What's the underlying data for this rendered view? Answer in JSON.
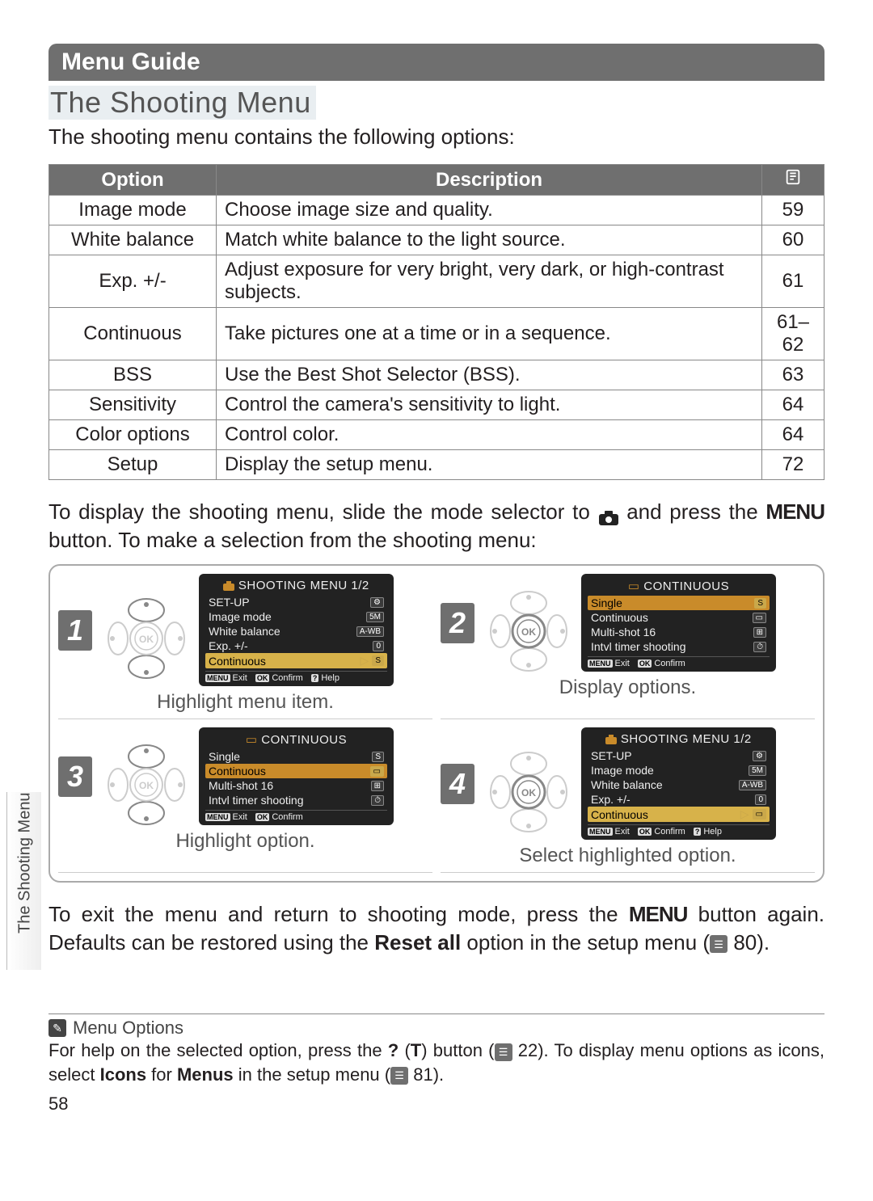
{
  "header": {
    "menu_guide": "Menu Guide"
  },
  "section": {
    "title": "The Shooting Menu",
    "intro": "The shooting menu contains the following options:"
  },
  "table": {
    "headers": {
      "option": "Option",
      "description": "Description"
    },
    "rows": [
      {
        "option": "Image mode",
        "desc": "Choose image size and quality.",
        "page": "59"
      },
      {
        "option": "White balance",
        "desc": "Match white balance to the light source.",
        "page": "60"
      },
      {
        "option": "Exp. +/-",
        "desc": "Adjust exposure for very bright, very dark, or high-contrast subjects.",
        "page": "61"
      },
      {
        "option": "Continuous",
        "desc": "Take pictures one at a time or in a sequence.",
        "page": "61–62"
      },
      {
        "option": "BSS",
        "desc": "Use the Best Shot Selector (BSS).",
        "page": "63"
      },
      {
        "option": "Sensitivity",
        "desc": "Control the camera's sensitivity to light.",
        "page": "64"
      },
      {
        "option": "Color options",
        "desc": "Control color.",
        "page": "64"
      },
      {
        "option": "Setup",
        "desc": "Display the setup menu.",
        "page": "72"
      }
    ]
  },
  "body1": {
    "pre": "To display the shooting menu, slide the mode selector to ",
    "mid": " and press the ",
    "menu_word": "MENU",
    "post": " button.  To make a selection from the shooting menu:"
  },
  "steps": [
    {
      "num": "1",
      "caption": "Highlight menu item.",
      "dpad": "vertical",
      "lcd": {
        "title": "SHOOTING MENU  1/2",
        "icon": "camera",
        "rows": [
          {
            "label": "SET-UP",
            "badge": "⚙",
            "sel": false
          },
          {
            "label": "Image mode",
            "badge": "5M",
            "sel": false
          },
          {
            "label": "White balance",
            "badge": "A-WB",
            "sel": false
          },
          {
            "label": "Exp. +/-",
            "badge": "0",
            "sel": false
          },
          {
            "label": "Continuous",
            "badge": "S",
            "sel": true,
            "arrow": true
          }
        ],
        "footer": [
          "MENU Exit",
          "OK Confirm",
          "? Help"
        ]
      }
    },
    {
      "num": "2",
      "caption": "Display options.",
      "dpad": "ok",
      "lcd": {
        "title": "CONTINUOUS",
        "icon": "burst",
        "rows": [
          {
            "label": "Single",
            "badge": "S",
            "sel": true
          },
          {
            "label": "Continuous",
            "badge": "▭",
            "sel": false
          },
          {
            "label": "Multi-shot 16",
            "badge": "⊞",
            "sel": false
          },
          {
            "label": "Intvl timer shooting",
            "badge": "⏱",
            "sel": false
          }
        ],
        "footer": [
          "MENU Exit",
          "OK Confirm"
        ]
      }
    },
    {
      "num": "3",
      "caption": "Highlight option.",
      "dpad": "vertical",
      "lcd": {
        "title": "CONTINUOUS",
        "icon": "burst",
        "rows": [
          {
            "label": "Single",
            "badge": "S",
            "sel": false
          },
          {
            "label": "Continuous",
            "badge": "▭",
            "sel": true
          },
          {
            "label": "Multi-shot 16",
            "badge": "⊞",
            "sel": false
          },
          {
            "label": "Intvl timer shooting",
            "badge": "⏱",
            "sel": false
          }
        ],
        "footer": [
          "MENU Exit",
          "OK Confirm"
        ]
      }
    },
    {
      "num": "4",
      "caption": "Select highlighted option.",
      "dpad": "ok",
      "lcd": {
        "title": "SHOOTING MENU  1/2",
        "icon": "camera",
        "rows": [
          {
            "label": "SET-UP",
            "badge": "⚙",
            "sel": false
          },
          {
            "label": "Image mode",
            "badge": "5M",
            "sel": false
          },
          {
            "label": "White balance",
            "badge": "A-WB",
            "sel": false
          },
          {
            "label": "Exp. +/-",
            "badge": "0",
            "sel": false
          },
          {
            "label": "Continuous",
            "badge": "▭",
            "sel": true,
            "arrow": true
          }
        ],
        "footer": [
          "MENU Exit",
          "OK Confirm",
          "? Help"
        ]
      }
    }
  ],
  "body2": {
    "pre": "To exit the menu and return to shooting mode, press the ",
    "menu_word": "MENU",
    "mid": " button again. Defaults can be restored using the ",
    "reset": "Reset all",
    "post": " option in the setup menu (",
    "ref": "80",
    "end": ")."
  },
  "side_tab": "The Shooting Menu",
  "tip": {
    "title": "Menu Options",
    "line1_pre": "For help on the selected option, press the ",
    "q_label": "?",
    "t_label": "T",
    "line1_mid": ") button (",
    "ref1": "22",
    "line1_post": ").  To display menu options as icons, select ",
    "icons_word": "Icons",
    "for_word": " for ",
    "menus_word": "Menus",
    "line1_tail": " in the setup menu (",
    "ref2": "81",
    "end": ")."
  },
  "page_number": "58"
}
